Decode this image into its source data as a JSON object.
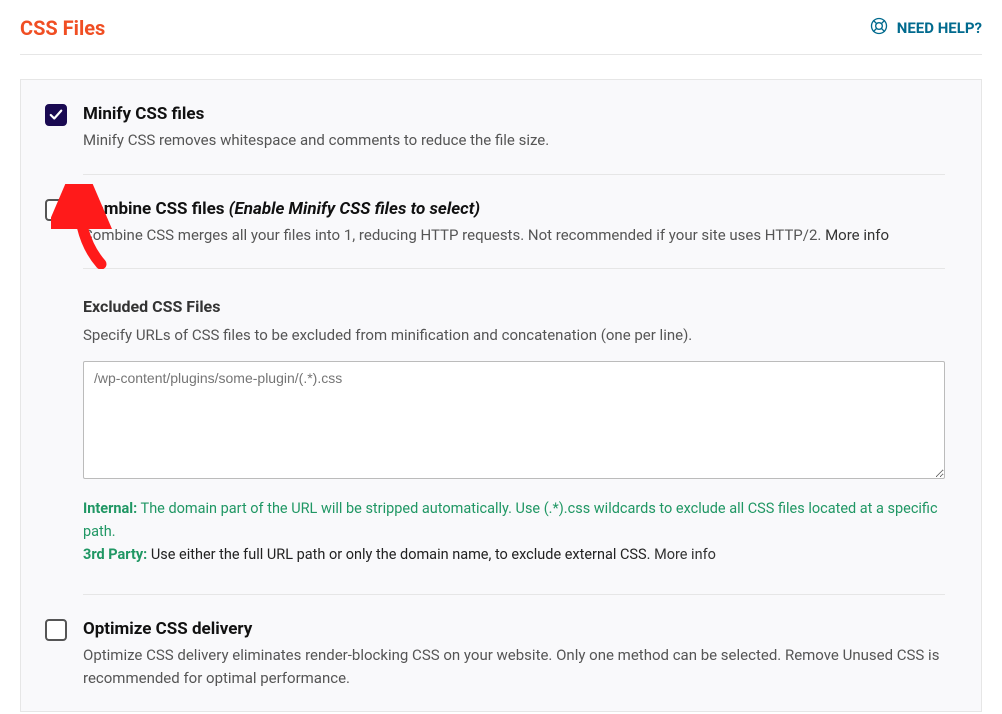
{
  "pageTitle": "CSS Files",
  "help": {
    "label": "NEED HELP?"
  },
  "settings": {
    "minify": {
      "label": "Minify CSS files",
      "desc": "Minify CSS removes whitespace and comments to reduce the file size."
    },
    "combine": {
      "label": "Combine CSS files ",
      "hint": "(Enable Minify CSS files to select)",
      "desc": "Combine CSS merges all your files into 1, reducing HTTP requests. Not recommended if your site uses HTTP/2. ",
      "more": "More info"
    },
    "excluded": {
      "label": "Excluded CSS Files",
      "desc": "Specify URLs of CSS files to be excluded from minification and concatenation (one per line).",
      "placeholder": "/wp-content/plugins/some-plugin/(.*).css",
      "noteInternalLabel": "Internal:",
      "noteInternal": " The domain part of the URL will be stripped automatically. Use (.*).css wildcards to exclude all CSS files located at a specific path.",
      "note3rdLabel": "3rd Party:",
      "note3rd": " Use either the full URL path or only the domain name, to exclude external CSS. ",
      "more": "More info"
    },
    "optimize": {
      "label": "Optimize CSS delivery",
      "desc": "Optimize CSS delivery eliminates render-blocking CSS on your website. Only one method can be selected. Remove Unused CSS is recommended for optimal performance."
    }
  }
}
